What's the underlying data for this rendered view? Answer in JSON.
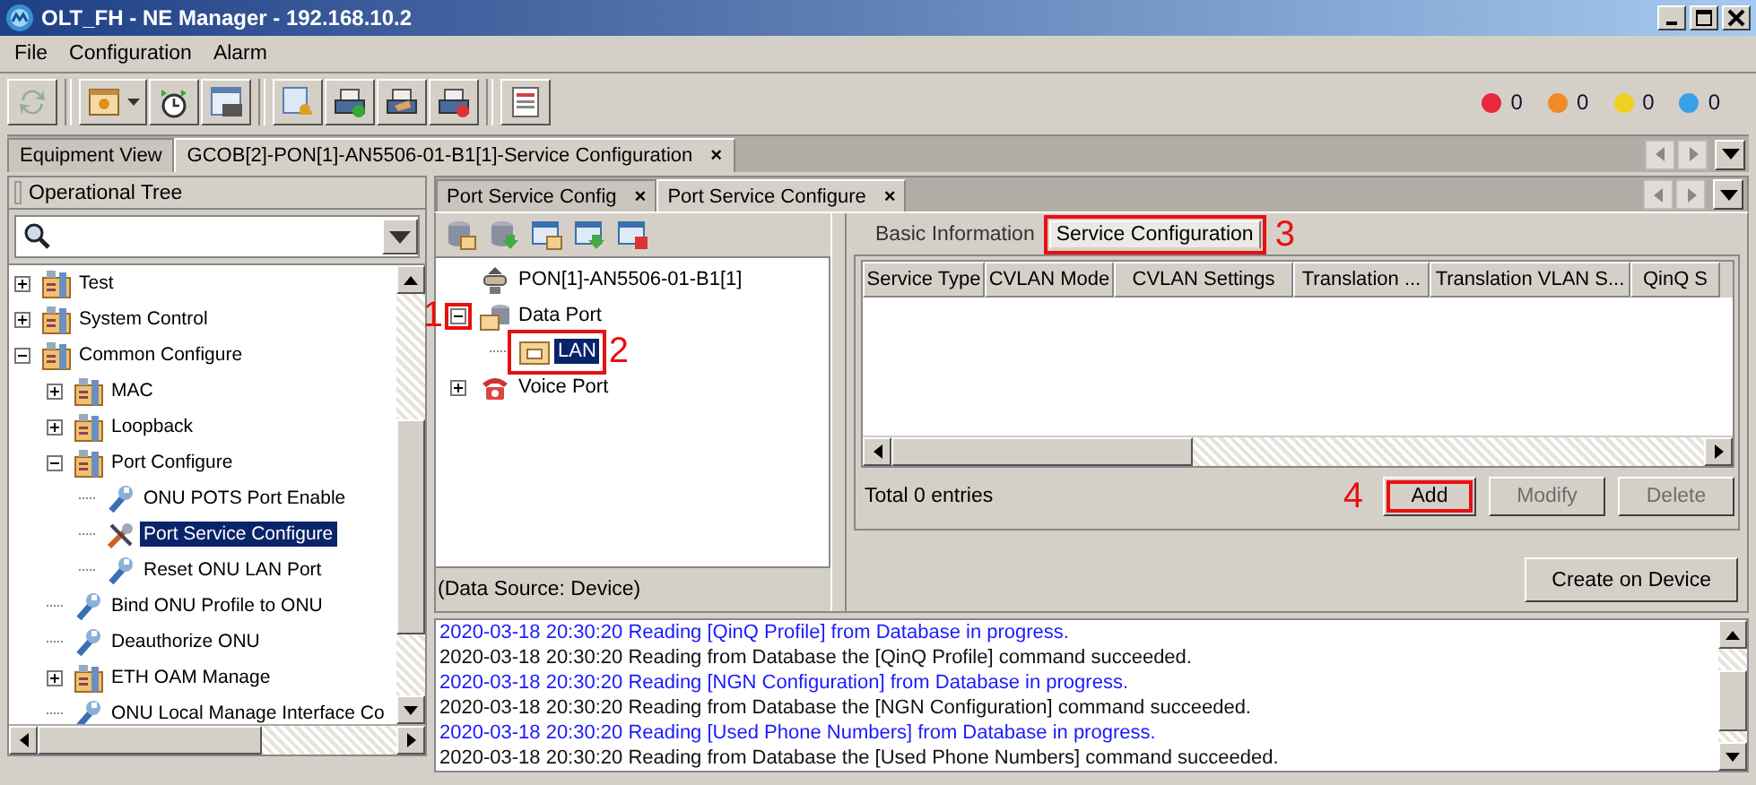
{
  "window": {
    "title": "OLT_FH - NE Manager - 192.168.10.2"
  },
  "menu": [
    "File",
    "Configuration",
    "Alarm"
  ],
  "toolbar": [
    [
      {
        "disabled": true
      }
    ],
    [
      {
        "disabled": false,
        "dropdown": true
      },
      {
        "disabled": false
      },
      {
        "disabled": false
      }
    ],
    [
      {
        "disabled": false
      },
      {
        "disabled": false
      },
      {
        "disabled": false
      },
      {
        "disabled": false
      }
    ],
    [
      {
        "disabled": false
      }
    ]
  ],
  "alarms": [
    {
      "color": "#e8283c",
      "count": "0"
    },
    {
      "color": "#f08a24",
      "count": "0"
    },
    {
      "color": "#f0d020",
      "count": "0"
    },
    {
      "color": "#3aa0e8",
      "count": "0"
    }
  ],
  "document_tabs": [
    {
      "label": "Equipment View",
      "selected": false
    },
    {
      "label": "GCOB[2]-PON[1]-AN5506-01-B1[1]-Service Configuration",
      "selected": true,
      "close": "×"
    }
  ],
  "operational_tree": {
    "title": "Operational Tree",
    "items": [
      {
        "label": "Test",
        "kind": "group",
        "expanded": false,
        "selected": false
      },
      {
        "label": "System Control",
        "kind": "group",
        "expanded": false,
        "selected": false
      },
      {
        "label": "Common Configure",
        "kind": "group",
        "expanded": true,
        "selected": false,
        "children": [
          {
            "label": "MAC",
            "kind": "group",
            "expanded": false,
            "selected": false
          },
          {
            "label": "Loopback",
            "kind": "group",
            "expanded": false,
            "selected": false
          },
          {
            "label": "Port Configure",
            "kind": "group",
            "expanded": true,
            "selected": false,
            "children": [
              {
                "label": "ONU POTS Port Enable",
                "kind": "task",
                "selected": false
              },
              {
                "label": "Port Service Configure",
                "kind": "tools",
                "selected": true
              },
              {
                "label": "Reset ONU LAN Port",
                "kind": "task",
                "selected": false
              }
            ]
          },
          {
            "label": "Bind ONU Profile to ONU",
            "kind": "task",
            "selected": false
          },
          {
            "label": "Deauthorize ONU",
            "kind": "task",
            "selected": false
          },
          {
            "label": "ETH OAM Manage",
            "kind": "group",
            "expanded": false,
            "selected": false
          },
          {
            "label": "ONU Local Manage Interface Co",
            "kind": "task",
            "selected": false
          }
        ]
      }
    ]
  },
  "port_tabs": [
    {
      "label": "Port Service Config",
      "selected": false,
      "close": "×"
    },
    {
      "label": "Port Service Configure",
      "selected": true,
      "close": "×"
    }
  ],
  "port_tree": {
    "items": [
      {
        "label": "PON[1]-AN5506-01-B1[1]",
        "kind": "pon",
        "selected": false
      },
      {
        "label": "Data Port",
        "kind": "data",
        "expanded": true,
        "expander_callout": "1",
        "selected": false,
        "children": [
          {
            "label": "LAN",
            "kind": "lan",
            "selected": true,
            "callout": "2"
          }
        ]
      },
      {
        "label": "Voice Port",
        "kind": "voice",
        "expanded": false,
        "selected": false
      }
    ]
  },
  "data_source": "(Data Source: Device)",
  "detail_tabs": [
    {
      "label": "Basic Information",
      "selected": false
    },
    {
      "label": "Service Configuration",
      "selected": true,
      "callout": "3"
    }
  ],
  "table": {
    "columns": [
      "Service Type",
      "CVLAN Mode",
      "CVLAN Settings",
      "Translation ...",
      "Translation VLAN S...",
      "QinQ S"
    ],
    "total": "Total 0 entries"
  },
  "actions": [
    {
      "label": "Add",
      "disabled": false,
      "callout": "4"
    },
    {
      "label": "Modify",
      "disabled": true
    },
    {
      "label": "Delete",
      "disabled": true
    }
  ],
  "create_button": "Create on Device",
  "log": [
    {
      "kind": "progress",
      "text": "2020-03-18 20:30:20 Reading [QinQ Profile] from Database in progress."
    },
    {
      "kind": "success",
      "text": "2020-03-18 20:30:20 Reading from Database the [QinQ Profile] command succeeded."
    },
    {
      "kind": "progress",
      "text": "2020-03-18 20:30:20 Reading [NGN Configuration] from Database in progress."
    },
    {
      "kind": "success",
      "text": "2020-03-18 20:30:20 Reading from Database the [NGN Configuration] command succeeded."
    },
    {
      "kind": "progress",
      "text": "2020-03-18 20:30:20 Reading [Used Phone Numbers] from Database in progress."
    },
    {
      "kind": "success",
      "text": "2020-03-18 20:30:20 Reading from Database the [Used Phone Numbers] command succeeded."
    }
  ]
}
